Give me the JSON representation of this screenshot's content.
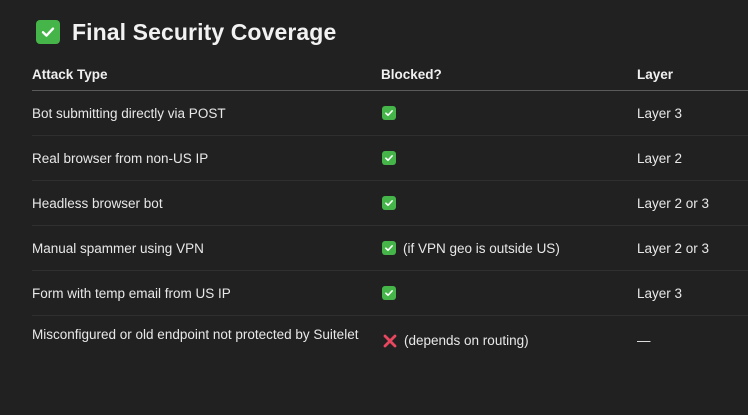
{
  "heading": {
    "icon": "check-mark-button-icon",
    "title": "Final Security Coverage"
  },
  "table": {
    "headers": [
      "Attack Type",
      "Blocked?",
      "Layer"
    ],
    "rows": [
      {
        "attack": "Bot submitting directly via POST",
        "blocked_icon": "check-mark-button-icon",
        "blocked_note": "",
        "layer": "Layer 3"
      },
      {
        "attack": "Real browser from non-US IP",
        "blocked_icon": "check-mark-button-icon",
        "blocked_note": "",
        "layer": "Layer 2"
      },
      {
        "attack": "Headless browser bot",
        "blocked_icon": "check-mark-button-icon",
        "blocked_note": "",
        "layer": "Layer 2 or 3"
      },
      {
        "attack": "Manual spammer using VPN",
        "blocked_icon": "check-mark-button-icon",
        "blocked_note": "(if VPN geo is outside US)",
        "layer": "Layer 2 or 3"
      },
      {
        "attack": "Form with temp email from US IP",
        "blocked_icon": "check-mark-button-icon",
        "blocked_note": "",
        "layer": "Layer 3"
      },
      {
        "attack": "Misconfigured or old endpoint not protected by Suitelet",
        "blocked_icon": "cross-mark-icon",
        "blocked_note": "(depends on routing)",
        "layer": "—"
      }
    ]
  },
  "colors": {
    "background": "#212121",
    "check_green": "#45b549",
    "cross_red": "#e8475f"
  }
}
